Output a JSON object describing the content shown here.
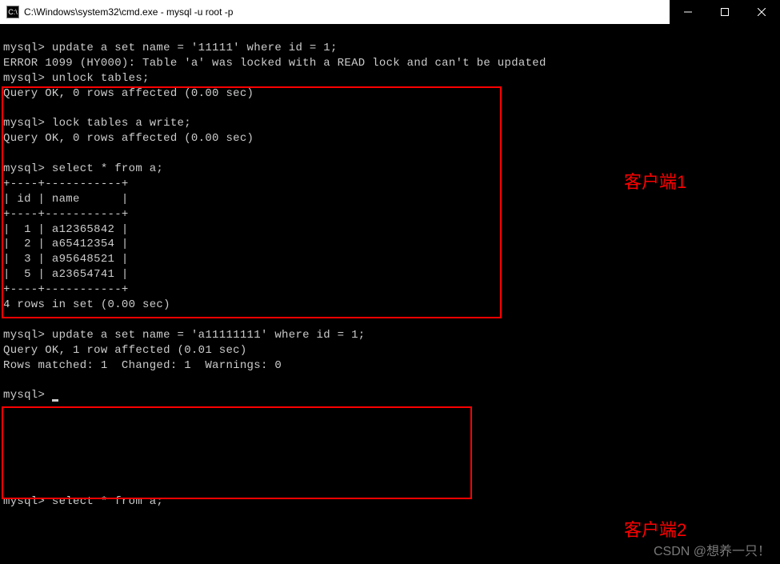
{
  "window": {
    "title": "C:\\Windows\\system32\\cmd.exe - mysql  -u root -p"
  },
  "terminal": {
    "line1": "mysql> update a set name = '11111' where id = 1;",
    "line2": "ERROR 1099 (HY000): Table 'a' was locked with a READ lock and can't be updated",
    "line3": "mysql> unlock tables;",
    "line4": "Query OK, 0 rows affected (0.00 sec)",
    "line5": "",
    "line6": "mysql> lock tables a write;",
    "line7": "Query OK, 0 rows affected (0.00 sec)",
    "line8": "",
    "line9": "mysql> select * from a;",
    "line10": "+----+-----------+",
    "line11": "| id | name      |",
    "line12": "+----+-----------+",
    "line13": "|  1 | a12365842 |",
    "line14": "|  2 | a65412354 |",
    "line15": "|  3 | a95648521 |",
    "line16": "|  5 | a23654741 |",
    "line17": "+----+-----------+",
    "line18": "4 rows in set (0.00 sec)",
    "line19": "",
    "line20": "mysql> update a set name = 'a11111111' where id = 1;",
    "line21": "Query OK, 1 row affected (0.01 sec)",
    "line22": "Rows matched: 1  Changed: 1  Warnings: 0",
    "line23": "",
    "line24": "mysql> ",
    "line25": "",
    "line26": "",
    "line27": "",
    "line28": "",
    "line29": "",
    "line30": "",
    "line31": "mysql> select * from a;"
  },
  "labels": {
    "client1": "客户端1",
    "client2": "客户端2"
  },
  "watermark": "CSDN @想养一只！",
  "chart_data": {
    "type": "table",
    "title": "select * from a",
    "columns": [
      "id",
      "name"
    ],
    "rows": [
      [
        1,
        "a12365842"
      ],
      [
        2,
        "a65412354"
      ],
      [
        3,
        "a95648521"
      ],
      [
        5,
        "a23654741"
      ]
    ],
    "row_count_message": "4 rows in set (0.00 sec)"
  }
}
